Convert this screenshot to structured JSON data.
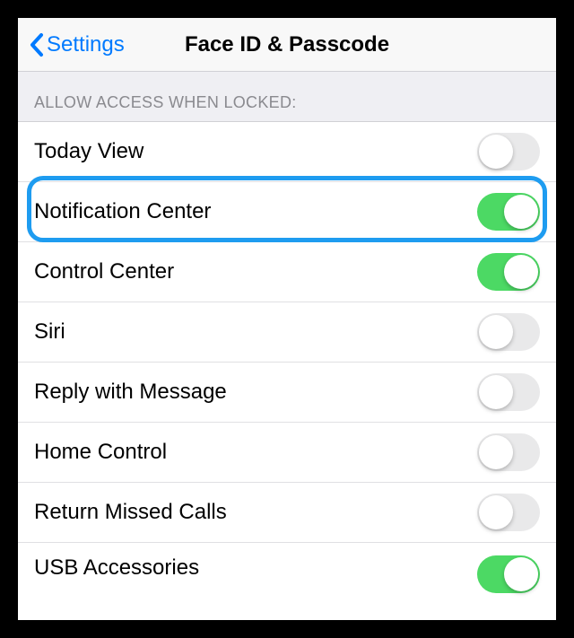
{
  "navbar": {
    "back_label": "Settings",
    "title": "Face ID & Passcode"
  },
  "section": {
    "header": "ALLOW ACCESS WHEN LOCKED:"
  },
  "rows": [
    {
      "label": "Today View",
      "on": false
    },
    {
      "label": "Notification Center",
      "on": true
    },
    {
      "label": "Control Center",
      "on": true
    },
    {
      "label": "Siri",
      "on": false
    },
    {
      "label": "Reply with Message",
      "on": false
    },
    {
      "label": "Home Control",
      "on": false
    },
    {
      "label": "Return Missed Calls",
      "on": false
    },
    {
      "label": "USB Accessories",
      "on": true
    }
  ],
  "highlighted_row_index": 1
}
